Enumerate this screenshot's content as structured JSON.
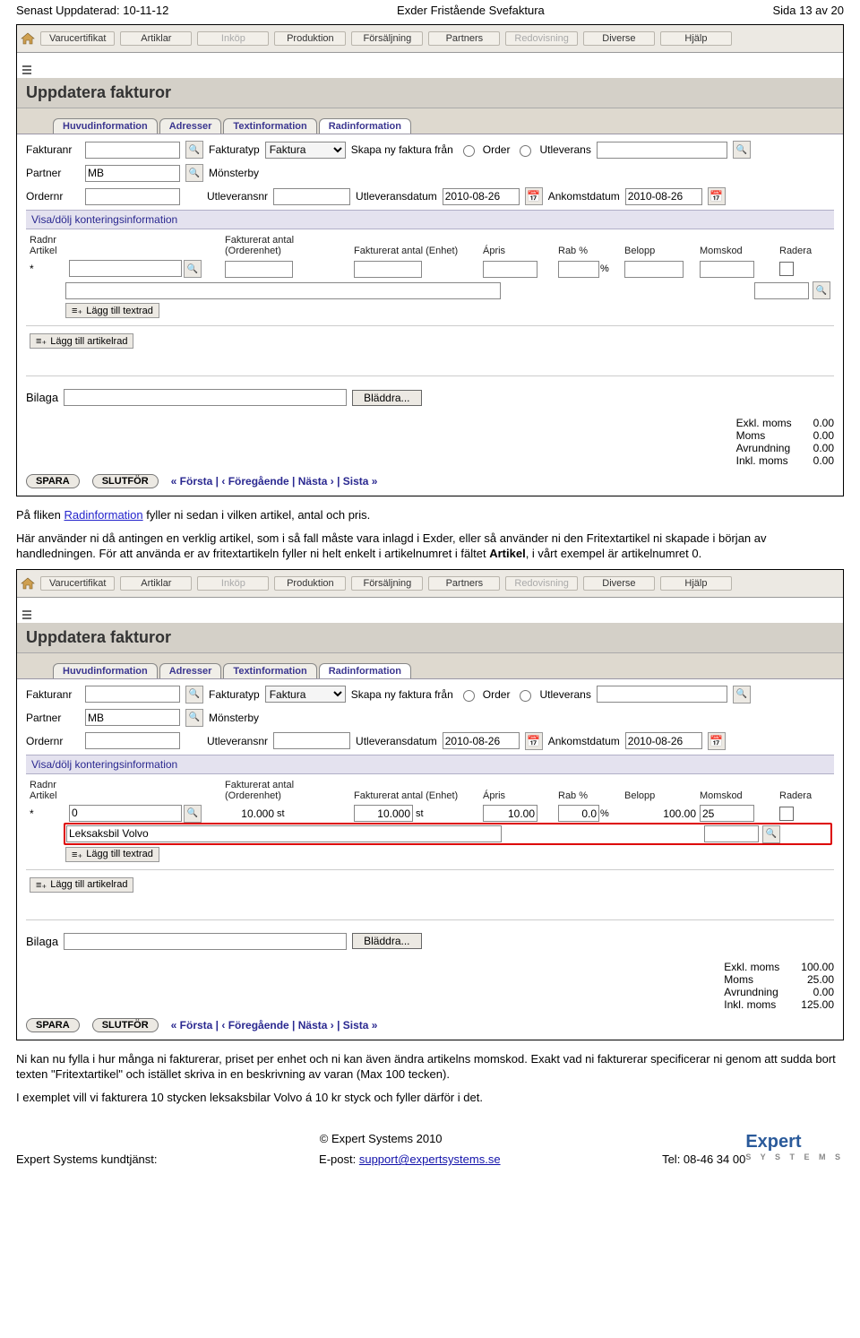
{
  "doc": {
    "left_header": "Senast Uppdaterad: 10-11-12",
    "center_header": "Exder Fristående Svefaktura",
    "right_header": "Sida 13 av 20"
  },
  "menu": {
    "items": [
      "Varucertifikat",
      "Artiklar",
      "Inköp",
      "Produktion",
      "Försäljning",
      "Partners",
      "Redovisning",
      "Diverse",
      "Hjälp"
    ],
    "disabled_idx": [
      2,
      6
    ]
  },
  "title": "Uppdatera fakturor",
  "tabs": [
    "Huvudinformation",
    "Adresser",
    "Textinformation",
    "Radinformation"
  ],
  "active_tab": 3,
  "form": {
    "fakturanr_label": "Fakturanr",
    "fakturatyp_label": "Fakturatyp",
    "fakturatyp_value": "Faktura",
    "skapa_label": "Skapa ny faktura från",
    "order_label": "Order",
    "utleverans_label": "Utleverans",
    "partner_label": "Partner",
    "partner_value": "MB",
    "partner_display": "Mönsterby",
    "ordernr_label": "Ordernr",
    "utleveransnr_label": "Utleveransnr",
    "utleveransdatum_label": "Utleveransdatum",
    "utleveransdatum_value": "2010-08-26",
    "ankomstdatum_label": "Ankomstdatum",
    "ankomstdatum_value": "2010-08-26"
  },
  "kontering_toggle": "Visa/dölj konteringsinformation",
  "grid_headers": {
    "radnr": "Radnr",
    "artikel": "Artikel",
    "fa_order": "Fakturerat antal (Orderenhet)",
    "fa_enhet": "Fakturerat antal (Enhet)",
    "apris": "Ápris",
    "rab": "Rab %",
    "belopp": "Belopp",
    "momskod": "Momskod",
    "radera": "Radera"
  },
  "screens": [
    {
      "row": {
        "radnr": "*",
        "artikel": "",
        "fa_order": "",
        "fa_enhet": "",
        "apris": "",
        "rab": "",
        "belopp": "",
        "momskod": ""
      },
      "desc": "",
      "totals": {
        "excl": "0.00",
        "moms": "0.00",
        "avr": "0.00",
        "incl": "0.00"
      }
    },
    {
      "row": {
        "radnr": "*",
        "artikel": "0",
        "fa_order": "10.000",
        "fa_order_unit": "st",
        "fa_enhet": "10.000",
        "fa_enhet_unit": "st",
        "apris": "10.00",
        "rab": "0.0",
        "belopp": "100.00",
        "momskod": "25"
      },
      "desc": "Leksaksbil Volvo",
      "totals": {
        "excl": "100.00",
        "moms": "25.00",
        "avr": "0.00",
        "incl": "125.00"
      },
      "highlight_desc": true
    }
  ],
  "add_textrad": "Lägg till textrad",
  "add_artikelrad": "Lägg till artikelrad",
  "bilaga_label": "Bilaga",
  "browse_label": "Bläddra...",
  "totals_labels": {
    "excl": "Exkl. moms",
    "moms": "Moms",
    "avr": "Avrundning",
    "incl": "Inkl. moms"
  },
  "buttons": {
    "spara": "SPARA",
    "slutfor": "SLUTFÖR"
  },
  "pager": "« Första | ‹ Föregående | Nästa › | Sista »",
  "body_text": {
    "p1a": "På fliken ",
    "p1_link": "Radinformation",
    "p1b": " fyller ni sedan i vilken artikel, antal och pris.",
    "p2a": "Här använder ni då antingen en verklig artikel, som i så fall måste vara inlagd i Exder, eller så använder ni den Fritextartikel ni skapade i början av handledningen. För att använda er av fritextartikeln fyller ni helt enkelt i artikelnumret i fältet ",
    "p2_bold": "Artikel",
    "p2b": ", i vårt exempel är artikelnumret 0.",
    "p3": "Ni kan nu fylla i hur många ni fakturerar, priset per enhet och ni kan även ändra artikelns momskod. Exakt vad ni fakturerar specificerar ni genom att sudda bort texten \"Fritextartikel\" och istället skriva in en beskrivning av varan (Max 100 tecken).",
    "p4": "I exemplet vill vi fakturera 10 stycken leksaksbilar Volvo á 10 kr styck och fyller därför i det."
  },
  "footer": {
    "copyright": "© Expert Systems 2010",
    "left": "Expert Systems kundtjänst:",
    "mid_label": "E-post: ",
    "mid_link": "support@expertsystems.se",
    "right": "Tel: 08-46 34 00",
    "logo_main": "Expert",
    "logo_sub": "S Y S T E M S"
  }
}
